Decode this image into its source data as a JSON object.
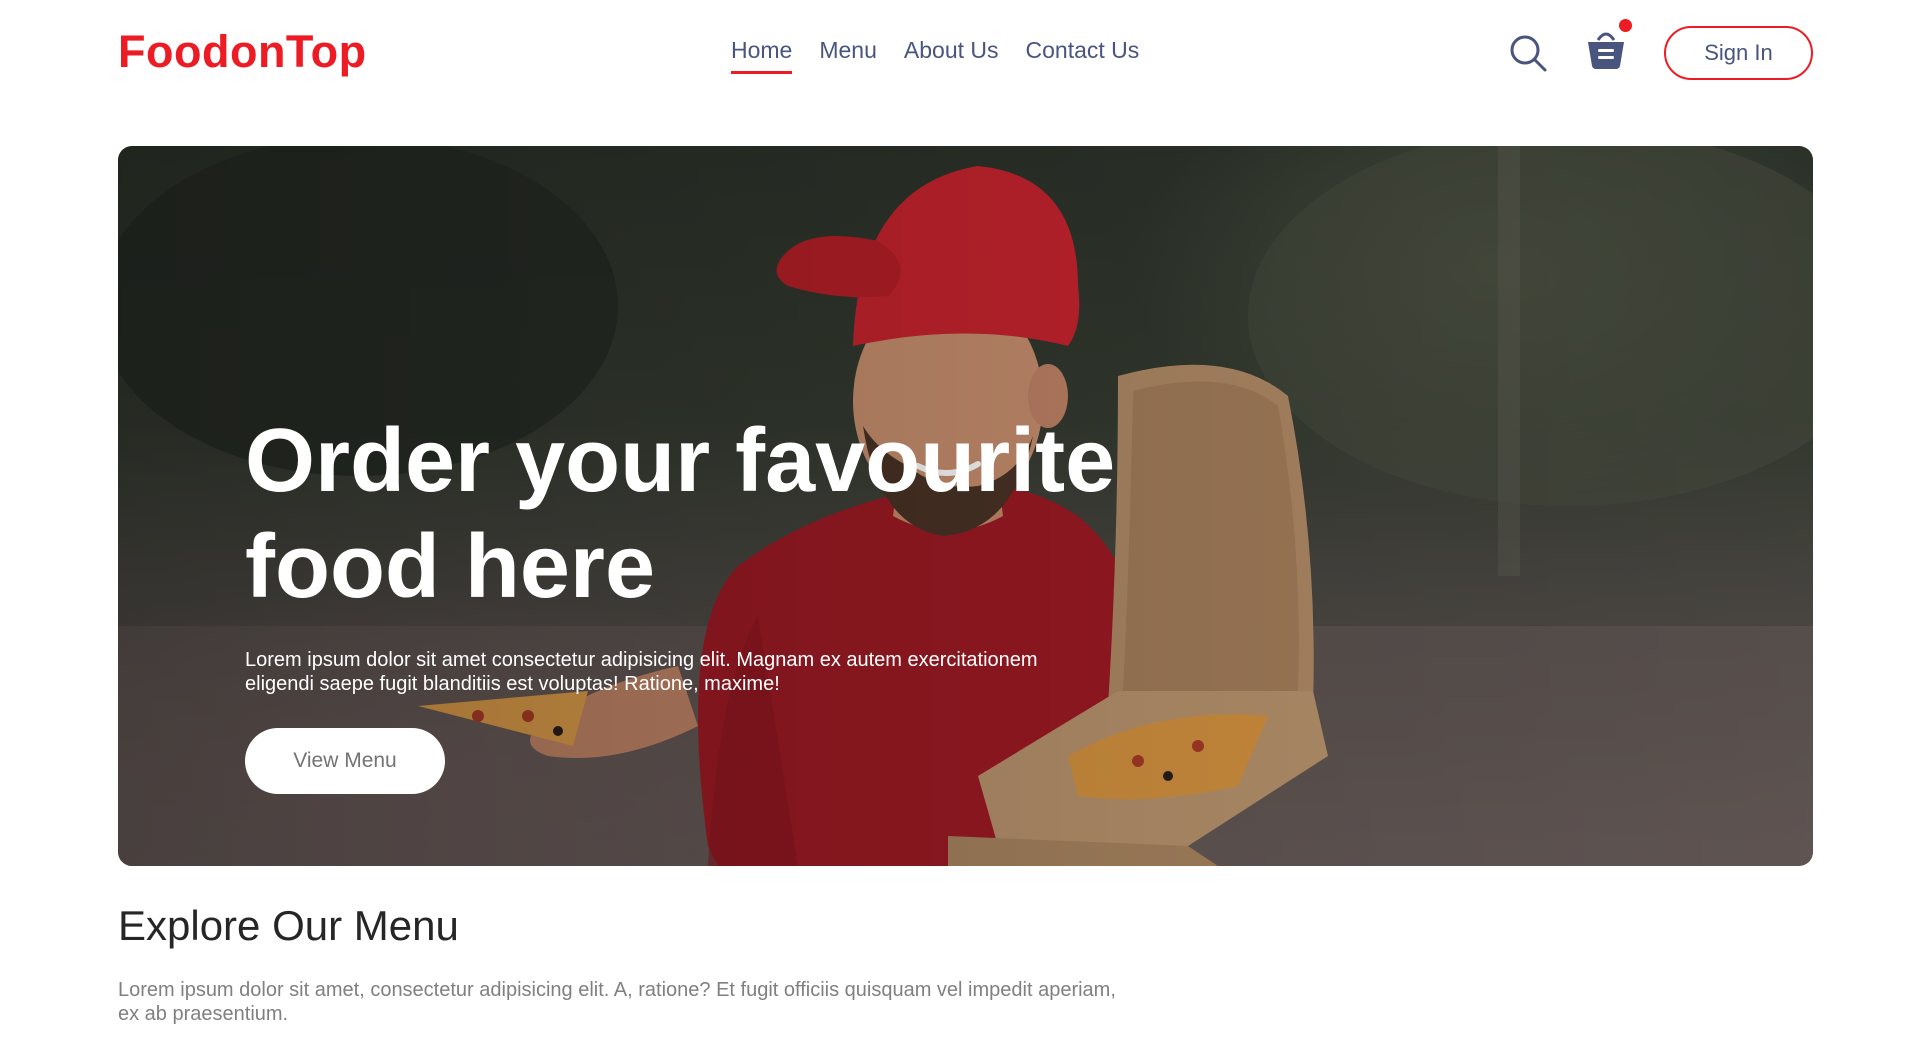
{
  "brand": {
    "logo_text": "FoodonTop",
    "accent_color": "#ed1c24",
    "nav_text_color": "#49557e"
  },
  "navbar": {
    "links": [
      {
        "label": "Home",
        "active": true
      },
      {
        "label": "Menu",
        "active": false
      },
      {
        "label": "About Us",
        "active": false
      },
      {
        "label": "Contact Us",
        "active": false
      }
    ],
    "search_icon": "search-icon",
    "cart_icon": "basket-icon",
    "cart_has_items": true,
    "sign_in_label": "Sign In"
  },
  "hero": {
    "title": "Order your favourite food here",
    "text": "Lorem ipsum dolor sit amet consectetur adipisicing elit. Magnam ex autem exercitationem eligendi saepe fugit blanditiis est voluptas! Ratione, maxime!",
    "button_label": "View Menu",
    "image_subject": "delivery man in red cap holding pizza box and pizza slice"
  },
  "explore": {
    "title": "Explore Our Menu",
    "text": "Lorem ipsum dolor sit amet, consectetur adipisicing elit. A, ratione? Et fugit officiis quisquam vel impedit aperiam, ex ab praesentium."
  }
}
